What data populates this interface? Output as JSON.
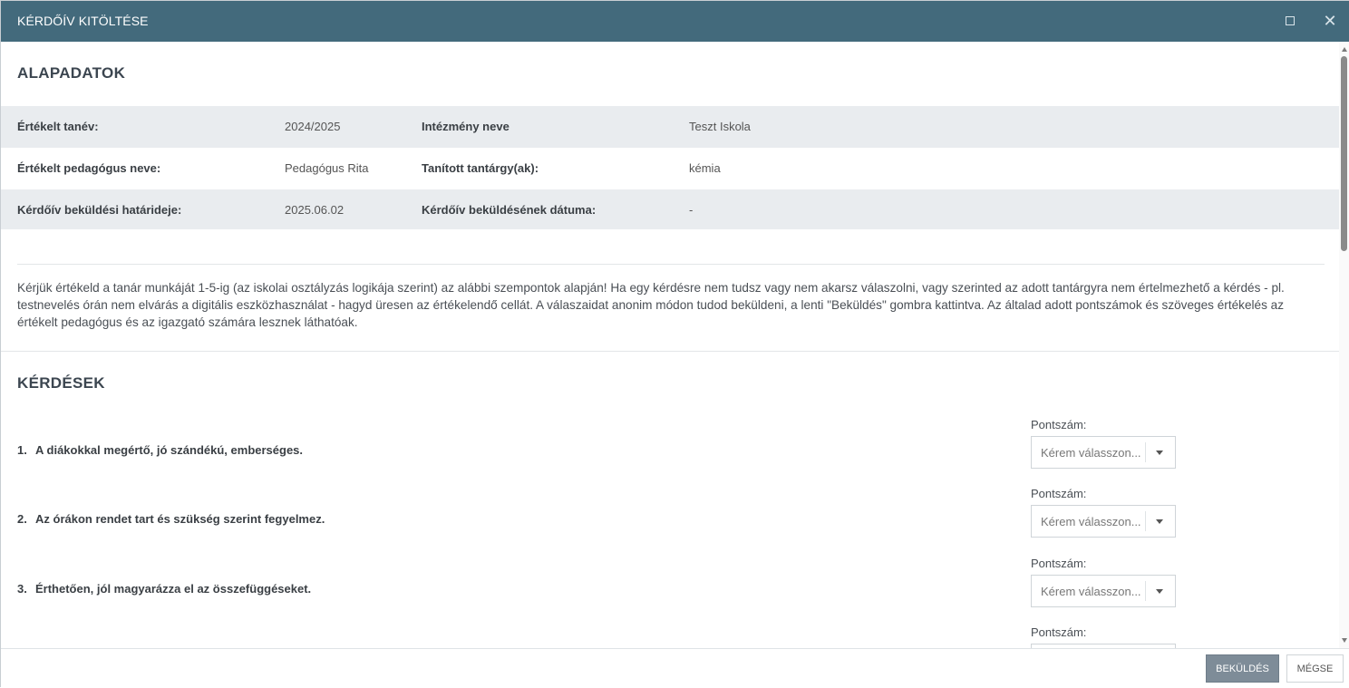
{
  "window": {
    "title": "KÉRDŐÍV KITÖLTÉSE"
  },
  "basic": {
    "title": "ALAPADATOK",
    "rows": [
      {
        "label1": "Értékelt tanév:",
        "value1": "2024/2025",
        "label2": "Intézmény neve",
        "value2": "Teszt Iskola"
      },
      {
        "label1": "Értékelt pedagógus neve:",
        "value1": "Pedagógus Rita",
        "label2": "Tanított tantárgy(ak):",
        "value2": "kémia"
      },
      {
        "label1": "Kérdőív beküldési határideje:",
        "value1": "2025.06.02",
        "label2": "Kérdőív beküldésének dátuma:",
        "value2": "-"
      }
    ]
  },
  "intro": "Kérjük értékeld a tanár munkáját 1-5-ig (az iskolai osztályzás logikája szerint) az alábbi szempontok alapján! Ha egy kérdésre nem tudsz vagy nem akarsz válaszolni, vagy szerinted az adott tantárgyra nem értelmezhető a kérdés - pl. testnevelés órán nem elvárás a digitális eszközhasználat - hagyd üresen az értékelendő cellát. A válaszaidat anonim módon tudod beküldeni, a lenti \"Beküldés\" gombra kattintva. Az általad adott pontszámok és szöveges értékelés az értékelt pedagógus és az igazgató számára lesznek láthatóak.",
  "questions": {
    "title": "KÉRDÉSEK",
    "score_label": "Pontszám:",
    "placeholder": "Kérem válasszon...",
    "items": [
      {
        "num": "1.",
        "text": "A diákokkal megértő, jó szándékú, emberséges."
      },
      {
        "num": "2.",
        "text": "Az órákon rendet tart és szükség szerint fegyelmez."
      },
      {
        "num": "3.",
        "text": "Érthetően, jól magyarázza el az összefüggéseket."
      },
      {
        "num": "",
        "text": ""
      }
    ]
  },
  "footer": {
    "submit": "BEKÜLDÉS",
    "cancel": "MÉGSE"
  }
}
